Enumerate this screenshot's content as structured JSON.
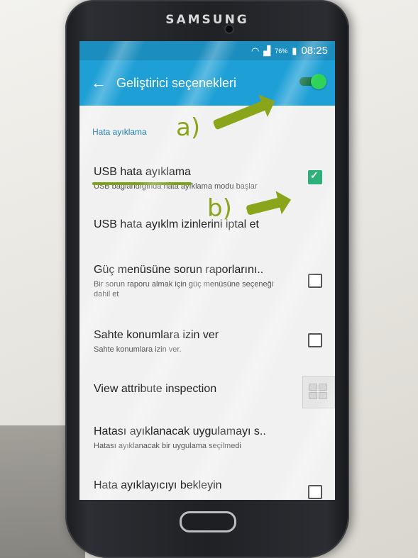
{
  "device": {
    "brand": "SAMSUNG"
  },
  "status_bar": {
    "battery": "76%",
    "time": "08:25"
  },
  "app_bar": {
    "title": "Geliştirici seçenekleri",
    "master_switch_on": true
  },
  "section_header": "Hata ayıklama",
  "settings": [
    {
      "title": "USB hata ayıklama",
      "subtitle": "USB bağlandığında hata ayıklama modu başlar",
      "control": "checkbox",
      "checked": true
    },
    {
      "title": "USB hata ayıklm izinlerini iptal et",
      "subtitle": "",
      "control": "none"
    },
    {
      "title": "Güç menüsüne sorun raporlarını..",
      "subtitle": "Bir sorun raporu almak için güç menüsüne seçeneği dahil et",
      "control": "checkbox",
      "checked": false
    },
    {
      "title": "Sahte konumlara izin ver",
      "subtitle": "Sahte konumlara izin ver.",
      "control": "checkbox",
      "checked": false
    },
    {
      "title": "View attribute inspection",
      "subtitle": "",
      "control": "grid-button"
    },
    {
      "title": "Hatası ayıklanacak uygulamayı s..",
      "subtitle": "Hatası ayıklanacak bir uygulama seçilmedi",
      "control": "none"
    },
    {
      "title": "Hata ayıklayıcıyı bekleyin",
      "subtitle": "",
      "control": "checkbox",
      "checked": false
    }
  ],
  "annotations": {
    "a": "a)",
    "b": "b)"
  },
  "colors": {
    "status_bar": "#1b8dbf",
    "app_bar": "#1ea0d6",
    "accent_green": "#2fd35a",
    "annotation": "#8aa51a"
  }
}
